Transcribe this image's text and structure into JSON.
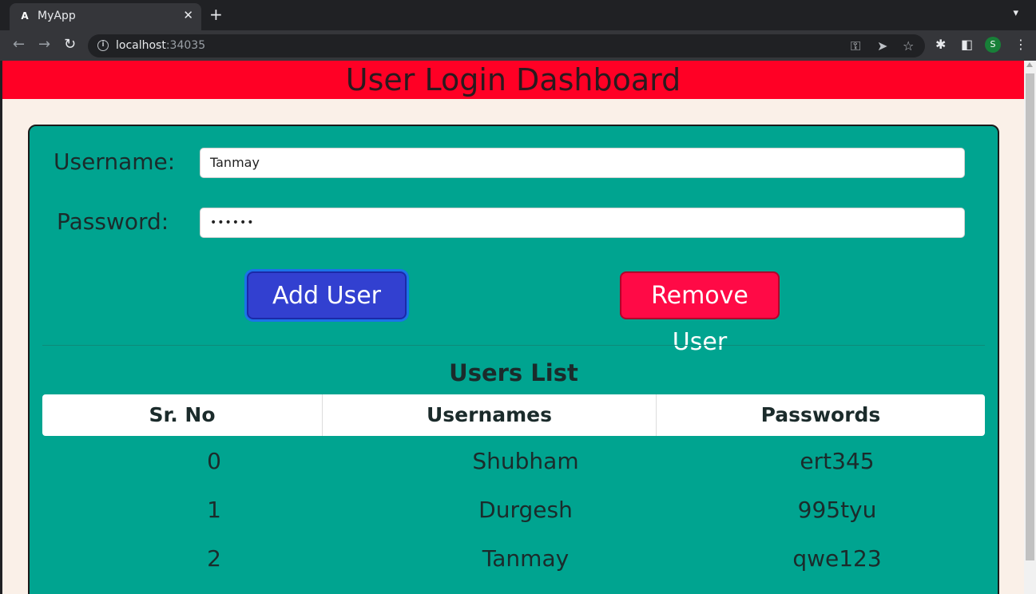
{
  "browser": {
    "tab_title": "MyApp",
    "tab_favicon": "A",
    "url_host": "localhost",
    "url_port": ":34035",
    "profile_initial": "S"
  },
  "page": {
    "header_title": "User Login Dashboard",
    "username_label": "Username:",
    "username_value": "Tanmay",
    "password_label": "Password:",
    "password_value": "••••••",
    "add_button": "Add User",
    "remove_button": "Remove User",
    "list_title": "Users List",
    "columns": [
      "Sr. No",
      "Usernames",
      "Passwords"
    ],
    "rows": [
      {
        "sr": "0",
        "username": "Shubham",
        "password": "ert345"
      },
      {
        "sr": "1",
        "username": "Durgesh",
        "password": "995tyu"
      },
      {
        "sr": "2",
        "username": "Tanmay",
        "password": "qwe123"
      }
    ]
  }
}
